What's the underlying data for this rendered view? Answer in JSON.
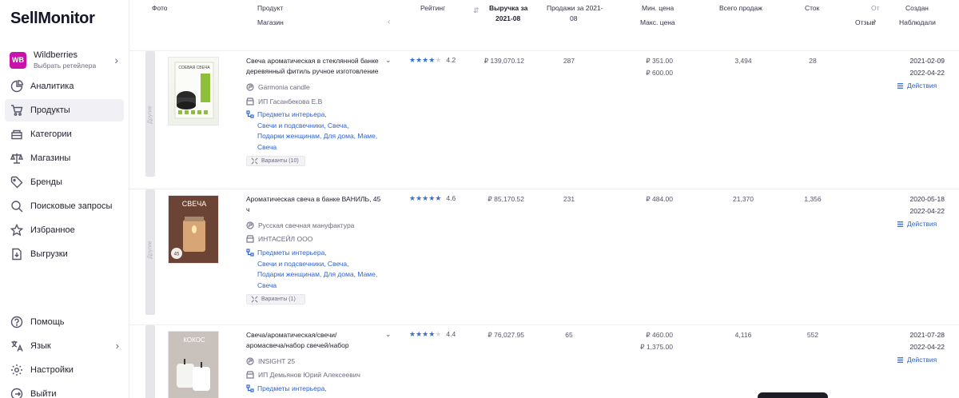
{
  "app": {
    "logo_text": "SellMonitor"
  },
  "sidebar": {
    "retailer": {
      "badge": "WB",
      "name": "Wildberries",
      "sub": "Выбрать ретейлера"
    },
    "items": [
      {
        "label": "Аналитика",
        "icon": "pie-chart-icon"
      },
      {
        "label": "Продукты",
        "icon": "cart-icon",
        "active": true
      },
      {
        "label": "Категории",
        "icon": "layers-icon"
      },
      {
        "label": "Магазины",
        "icon": "scales-icon"
      },
      {
        "label": "Бренды",
        "icon": "tag-icon"
      },
      {
        "label": "Поисковые запросы",
        "icon": "search-icon"
      },
      {
        "label": "Избранное",
        "icon": "star-icon"
      },
      {
        "label": "Выгрузки",
        "icon": "download-icon"
      }
    ],
    "bottom_items": [
      {
        "label": "Помощь",
        "icon": "help-icon"
      },
      {
        "label": "Язык",
        "icon": "translate-icon"
      },
      {
        "label": "Настройки",
        "icon": "gear-icon"
      },
      {
        "label": "Выйти",
        "icon": "logout-icon"
      }
    ]
  },
  "table": {
    "headers": {
      "photo": "Фото",
      "product": "Продукт",
      "shop": "Магазин",
      "rating": "Рейтинг",
      "revenue_l1": "Выручка за",
      "revenue_l2": "2021-08",
      "sales_l1": "Продажи за 2021-",
      "sales_l2": "08",
      "min_price": "Мин. цена",
      "max_price": "Макс. цена",
      "total_sales": "Всего продаж",
      "stock": "Сток",
      "reviews_l1": "От",
      "reviews_l2": "Отзыв",
      "created": "Создан",
      "observed": "Наблюдали"
    },
    "rows": [
      {
        "title_l1": "Свеча ароматическая в стеклянной банке",
        "title_l2": "деревянный фитиль ручное изготовление",
        "brand": "Garmonia candle",
        "seller": "ИП Гасанбекова Е.В",
        "categories": [
          "Предметы интерьера,",
          "Свечи и подсвечники, Свеча,",
          "Подарки женщинам, Для дома, Маме,",
          "Свеча"
        ],
        "variants": "Варианты (10)",
        "rating": "4.2",
        "rating_value": 4.2,
        "revenue": "₽ 139,070.12",
        "sales": "287",
        "min_price": "₽ 351.00",
        "max_price": "₽ 600.00",
        "total_sales": "3,494",
        "stock": "28",
        "created": "2021-02-09",
        "observed": "2022-04-22",
        "actions": "Действия",
        "side_label": "Другие"
      },
      {
        "title_l1": "Ароматическая свеча в банке ВАНИЛЬ, 45",
        "title_l2": "ч",
        "brand": "Русская свечная мануфактура",
        "seller": "ИНТАСЕЙЛ ООО",
        "categories": [
          "Предметы интерьера,",
          "Свечи и подсвечники, Свеча,",
          "Подарки женщинам, Для дома, Маме,",
          "Свеча"
        ],
        "variants": "Варианты (1)",
        "rating": "4.6",
        "rating_value": 4.6,
        "revenue": "₽ 85,170.52",
        "sales": "231",
        "min_price": "₽ 484.00",
        "max_price": "",
        "total_sales": "21,370",
        "stock": "1,356",
        "created": "2020-05-18",
        "observed": "2022-04-22",
        "actions": "Действия",
        "side_label": "Другие"
      },
      {
        "title_l1": "Свеча/ароматическая/свечи/",
        "title_l2": "аромасвеча/набор свечей/набор",
        "brand": "INSIGHT 25",
        "seller": "ИП Демьянов Юрий Алексеевич",
        "categories": [
          "Предметы интерьера,"
        ],
        "variants": "",
        "rating": "4.4",
        "rating_value": 4.4,
        "revenue": "₽ 76,027.95",
        "sales": "65",
        "min_price": "₽ 460.00",
        "max_price": "₽ 1,375.00",
        "total_sales": "4,116",
        "stock": "552",
        "created": "2021-07-28",
        "observed": "2022-04-22",
        "actions": "Действия",
        "side_label": ""
      }
    ]
  },
  "thumbnails": {
    "row0_text": "СОЕВАЯ СВЕЧА",
    "row1_text": "СВЕЧА",
    "row1_badge": "45",
    "row2_text": "КОКОС"
  },
  "colors": {
    "accent": "#2f63d6",
    "star": "#3a6fd8",
    "wb": "#cb11ab"
  }
}
